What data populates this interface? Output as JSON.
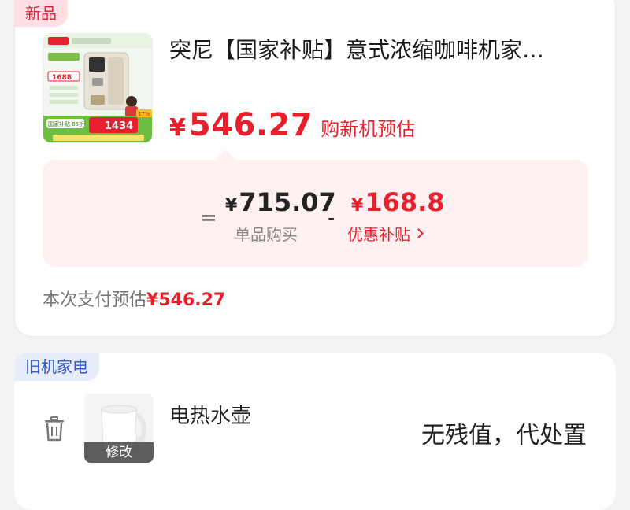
{
  "new_item": {
    "tag": "新品",
    "title": "突尼【国家补贴】意式浓缩咖啡机家…",
    "new_price_currency": "¥",
    "new_price_value": "546.27",
    "new_price_label": "购新机预估",
    "calc": {
      "equals": "=",
      "unit_price_currency": "¥",
      "unit_price_value": "715.07",
      "unit_price_label": "单品购买",
      "minus": "-",
      "subsidy_currency": "¥",
      "subsidy_value": "168.8",
      "subsidy_label": "优惠补贴"
    },
    "payment_label": "本次支付预估",
    "payment_amount": "¥546.27",
    "image": {
      "badges": [
        "国家补贴 85折",
        "1688",
        "1434",
        "17%"
      ]
    }
  },
  "old_item": {
    "tag": "旧机家电",
    "name": "电热水壶",
    "modify_label": "修改",
    "status": "无残值，代处置"
  },
  "colors": {
    "accent_red": "#e8202e",
    "tag_blue": "#2f58c9",
    "calc_bg": "#fff0f1"
  }
}
